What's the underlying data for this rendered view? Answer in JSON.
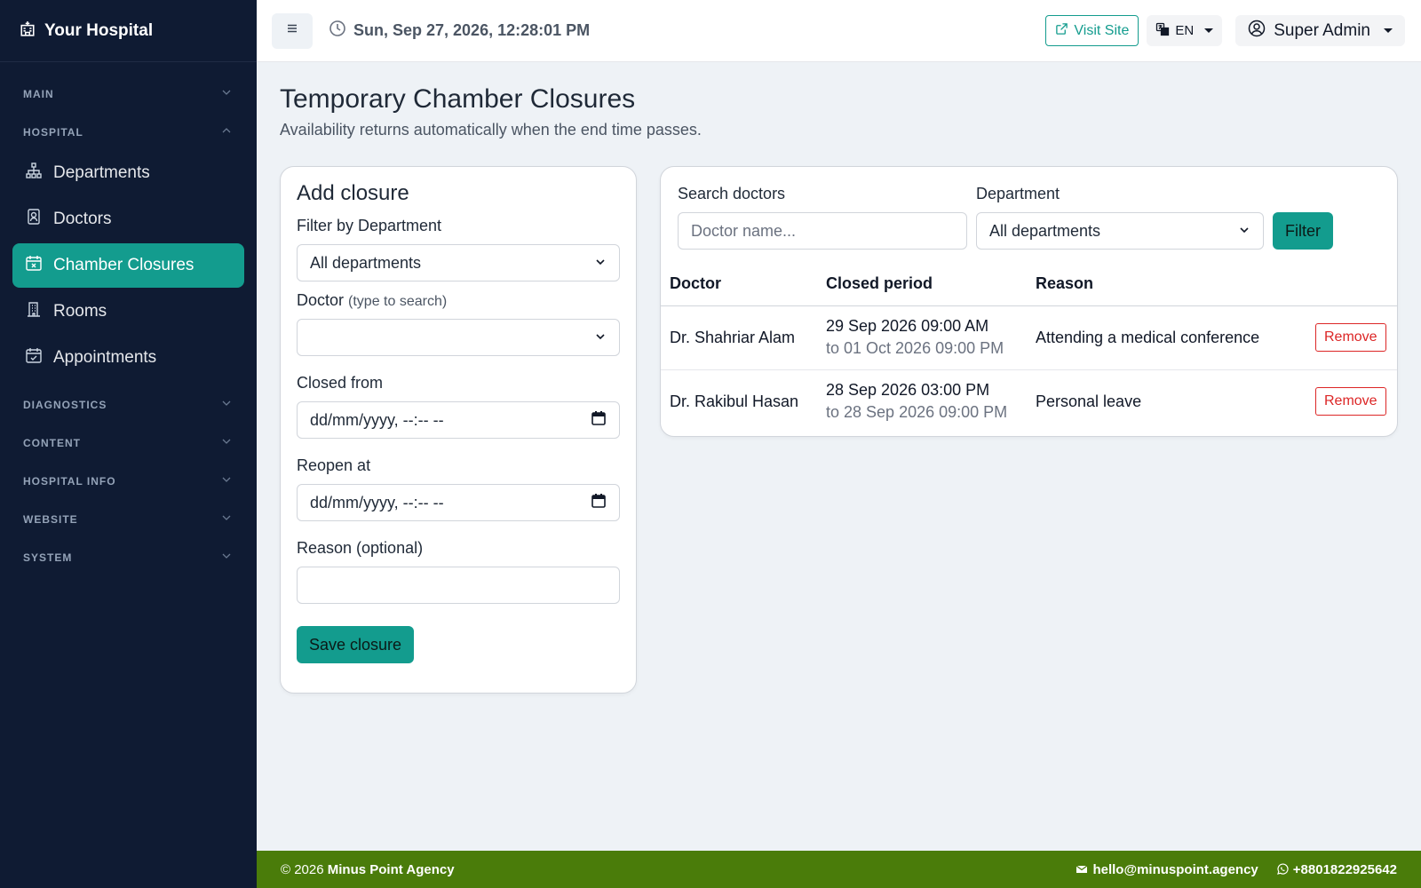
{
  "sidebar": {
    "brand": "Your Hospital",
    "sections": {
      "main": "MAIN",
      "hospital": "HOSPITAL",
      "diagnostics": "DIAGNOSTICS",
      "content": "CONTENT",
      "hospital_info": "HOSPITAL INFO",
      "website": "WEBSITE",
      "system": "SYSTEM"
    },
    "items": [
      {
        "label": "Departments",
        "icon": "sitemap-icon"
      },
      {
        "label": "Doctors",
        "icon": "doctor-badge-icon"
      },
      {
        "label": "Chamber Closures",
        "icon": "calendar-x-icon",
        "active": true
      },
      {
        "label": "Rooms",
        "icon": "building-icon"
      },
      {
        "label": "Appointments",
        "icon": "calendar-check-icon"
      }
    ]
  },
  "topbar": {
    "datetime": "Sun, Sep 27, 2026, 12:28:01 PM",
    "visit_site": "Visit Site",
    "language": "EN",
    "user": "Super Admin"
  },
  "page": {
    "title": "Temporary Chamber Closures",
    "subtitle": "Availability returns automatically when the end time passes."
  },
  "add_form": {
    "heading": "Add closure",
    "filter_label": "Filter by Department",
    "filter_value": "All departments",
    "doctor_label": "Doctor",
    "doctor_hint": "(type to search)",
    "doctor_value": "",
    "closed_from_label": "Closed from",
    "closed_from_placeholder": "dd/mm/yyyy, --:-- --",
    "reopen_label": "Reopen at",
    "reopen_placeholder": "dd/mm/yyyy, --:-- --",
    "reason_label": "Reason (optional)",
    "reason_value": "",
    "save_label": "Save closure"
  },
  "list": {
    "search_label": "Search doctors",
    "search_placeholder": "Doctor name...",
    "department_label": "Department",
    "department_value": "All departments",
    "filter_label": "Filter",
    "columns": [
      "Doctor",
      "Closed period",
      "Reason"
    ],
    "rows": [
      {
        "doctor": "Dr. Shahriar Alam",
        "from": "29 Sep 2026 09:00 AM",
        "to": "to 01 Oct 2026 09:00 PM",
        "reason": "Attending a medical conference",
        "action": "Remove"
      },
      {
        "doctor": "Dr. Rakibul Hasan",
        "from": "28 Sep 2026 03:00 PM",
        "to": "to 28 Sep 2026 09:00 PM",
        "reason": "Personal leave",
        "action": "Remove"
      }
    ]
  },
  "footer": {
    "copyright": "© 2026",
    "company": "Minus Point Agency",
    "email": "hello@minuspoint.agency",
    "phone": "+8801822925642"
  },
  "colors": {
    "sidebar_bg": "#0f1b33",
    "accent": "#139c8e",
    "danger": "#dc2626",
    "footer_bg": "#4a7c0a"
  }
}
